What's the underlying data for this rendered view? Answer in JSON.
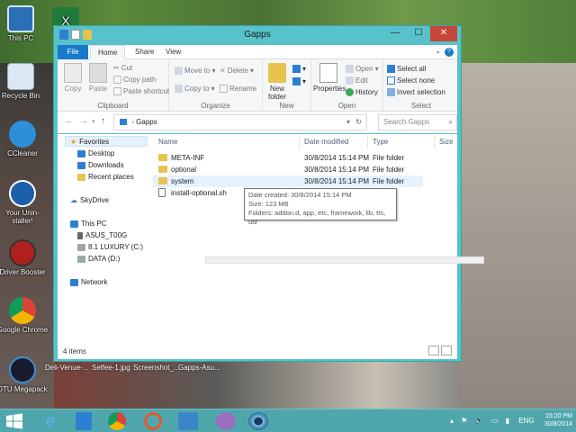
{
  "desktop": {
    "icons": [
      {
        "label": "This PC"
      },
      {
        "label": "Recycle Bin"
      },
      {
        "label": "CCleaner"
      },
      {
        "label": "Your Unin-staller!"
      },
      {
        "label": "Driver Booster"
      },
      {
        "label": "Google Chrome"
      },
      {
        "label": "DTU Megapack"
      }
    ],
    "bottom_files": [
      "Deli-Venue-...",
      "Selfee-1.jpg",
      "Screenshot_...",
      "Gapps-Asu..."
    ]
  },
  "window": {
    "title": "Gapps",
    "controls": {
      "minimize": "—",
      "maximize": "☐",
      "close": "✕"
    },
    "tabs": {
      "file": "File",
      "home": "Home",
      "share": "Share",
      "view": "View"
    },
    "ribbon": {
      "clipboard": {
        "copy": "Copy",
        "paste": "Paste",
        "cut": "Cut",
        "copy_path": "Copy path",
        "paste_shortcut": "Paste shortcut",
        "label": "Clipboard"
      },
      "organize": {
        "move_to": "Move to",
        "copy_to": "Copy to",
        "delete": "Delete",
        "rename": "Rename",
        "label": "Organize"
      },
      "new": {
        "new_folder": "New folder",
        "label": "New"
      },
      "open": {
        "properties": "Properties",
        "open": "Open",
        "edit": "Edit",
        "history": "History",
        "label": "Open"
      },
      "select": {
        "select_all": "Select all",
        "select_none": "Select none",
        "invert_selection": "Invert selection",
        "label": "Select"
      }
    },
    "address": {
      "path": "Gapps",
      "search_placeholder": "Search Gapps"
    },
    "nav": {
      "favorites": "Favorites",
      "desktop": "Desktop",
      "downloads": "Downloads",
      "recent": "Recent places",
      "skydrive": "SkyDrive",
      "this_pc": "This PC",
      "asus": "ASUS_T00G",
      "c_drive": "8.1 LUXURY (C:)",
      "d_drive": "DATA (D:)",
      "network": "Network"
    },
    "columns": {
      "name": "Name",
      "date": "Date modified",
      "type": "Type",
      "size": "Size"
    },
    "files": [
      {
        "name": "META-INF",
        "date": "30/8/2014 15:14 PM",
        "type": "File folder"
      },
      {
        "name": "optional",
        "date": "30/8/2014 15:14 PM",
        "type": "File folder"
      },
      {
        "name": "system",
        "date": "30/8/2014 15:14 PM",
        "type": "File folder"
      },
      {
        "name": "install-optional.sh",
        "date": "",
        "type": ""
      }
    ],
    "tooltip": {
      "line1": "Date created: 30/8/2014 15:14 PM",
      "line2": "Size: 123 MB",
      "line3": "Folders: addon.d, app, etc, framework, lib, tts, usr"
    },
    "status": {
      "count": "4 items"
    }
  },
  "taskbar": {
    "language": "ENG",
    "time": "15:20 PM",
    "date": "30/8/2014"
  }
}
